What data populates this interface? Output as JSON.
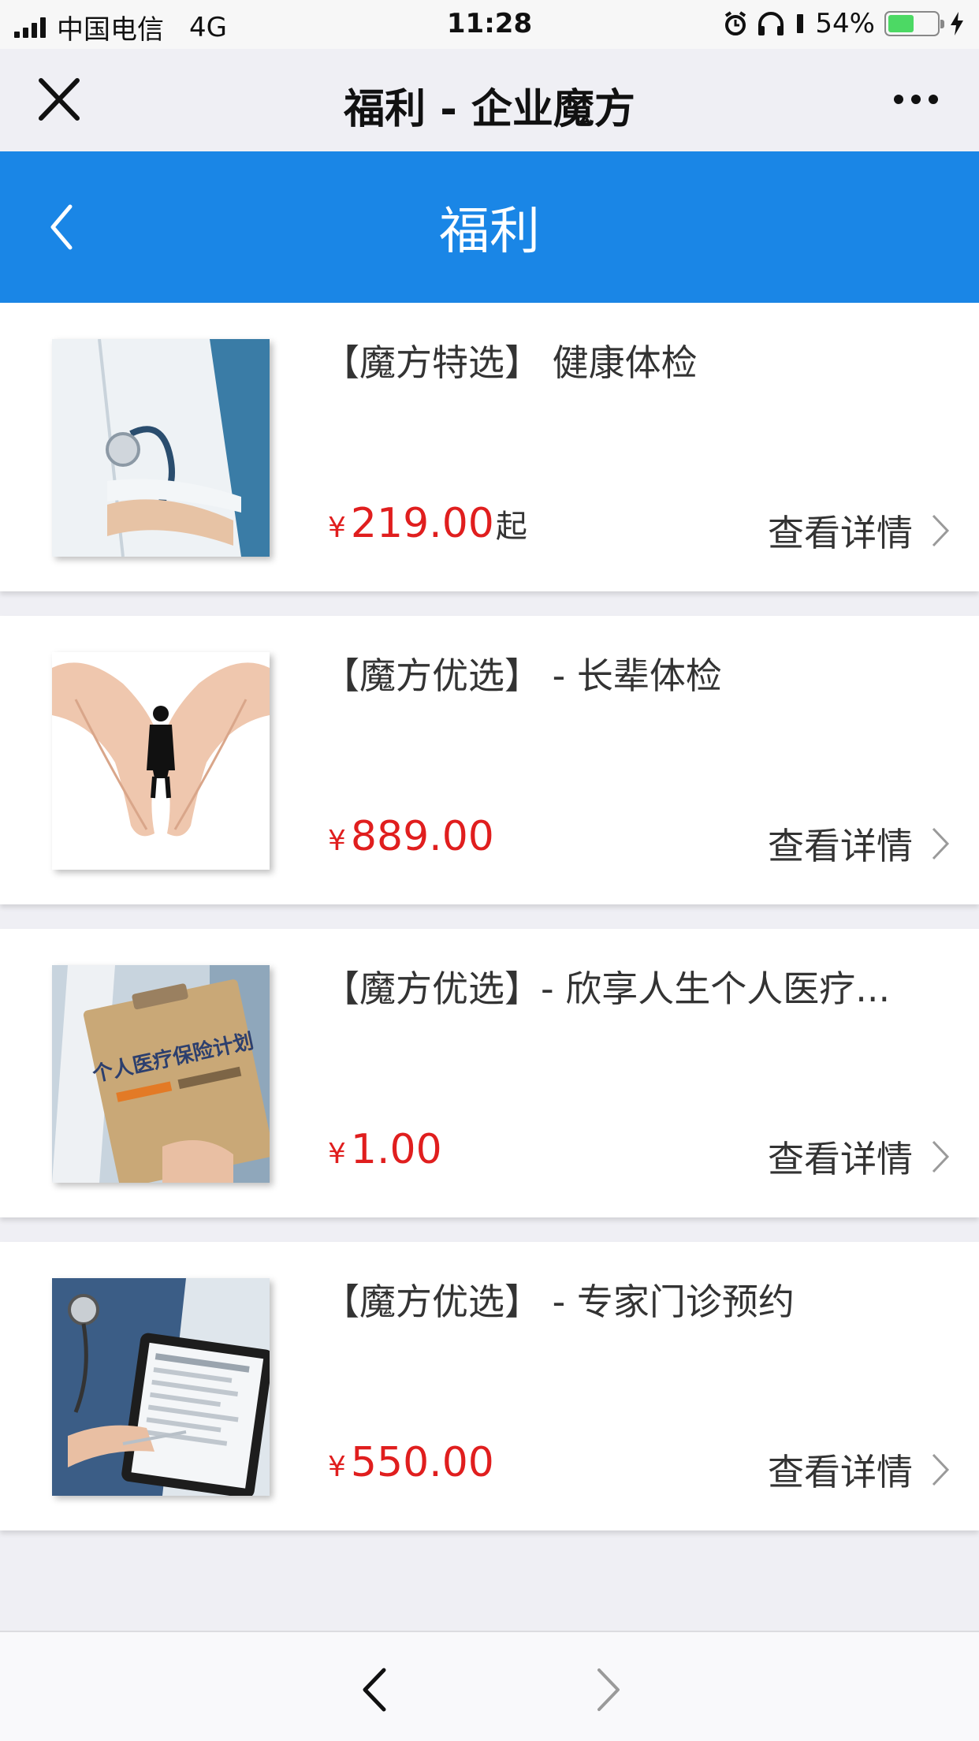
{
  "status_bar": {
    "carrier": "中国电信",
    "network": "4G",
    "time": "11:28",
    "battery_percent": "54%",
    "battery_level": 0.54
  },
  "wechat_nav": {
    "title": "福利 - 企业魔方",
    "close_icon": "close-icon",
    "more_icon": "more-icon"
  },
  "header": {
    "title": "福利",
    "back_icon": "chevron-left-icon",
    "background_color": "#1a86e6"
  },
  "items": [
    {
      "title": "【魔方特选】 健康体检",
      "currency": "¥",
      "price": "219.00",
      "price_suffix": "起",
      "detail_label": "查看详情",
      "image": "doctor-with-stethoscope"
    },
    {
      "title": "【魔方优选】 - 长辈体检",
      "currency": "¥",
      "price": "889.00",
      "price_suffix": "",
      "detail_label": "查看详情",
      "image": "hands-heart-elderly"
    },
    {
      "title": "【魔方优选】- 欣享人生个人医疗...",
      "currency": "¥",
      "price": "1.00",
      "price_suffix": "",
      "detail_label": "查看详情",
      "image": "insurance-clipboard",
      "image_text": "个人医疗保险计划"
    },
    {
      "title": "【魔方优选】 - 专家门诊预约",
      "currency": "¥",
      "price": "550.00",
      "price_suffix": "",
      "detail_label": "查看详情",
      "image": "doctor-with-tablet"
    }
  ],
  "colors": {
    "price": "#e01e1e",
    "accent": "#1a86e6"
  },
  "toolbar": {
    "back_icon": "chevron-left-icon",
    "forward_icon": "chevron-right-icon"
  }
}
